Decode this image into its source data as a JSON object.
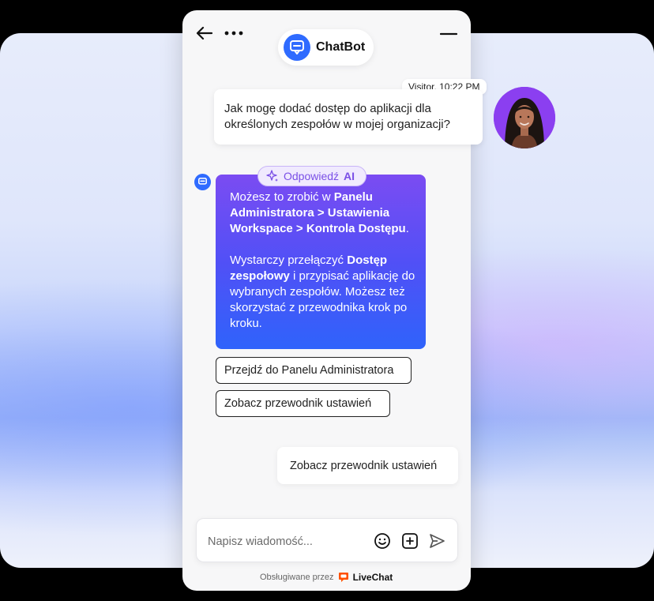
{
  "header": {
    "title": "ChatBot",
    "back_icon": "arrow-left-icon",
    "more_icon": "more-dots-icon",
    "minimize_icon": "minimize-icon"
  },
  "user_message": {
    "meta": "Visitor, 10:22 PM",
    "text_line1": "Jak mogę dodać dostęp do aplikacji dla",
    "text_line2": "określonych zespołów w mojej organizacji?"
  },
  "ai_message": {
    "badge_prefix": "Odpowiedź",
    "badge_ai": "AI",
    "p1_a": "Możesz to zrobić w ",
    "p1_b": "Panelu Administratora > Ustawienia Workspace > Kontrola Dostępu",
    "p1_c": ".",
    "p2_a": "Wystarczy przełączyć ",
    "p2_b": "Dostęp zespołowy",
    "p2_c": " i przypisać aplikację do wybranych zespołów. Możesz też skorzystać z przewodnika krok po kroku."
  },
  "actions": {
    "go_admin": "Przejdź do Panelu Administratora",
    "see_guide": "Zobacz przewodnik ustawień"
  },
  "sent_message": "Zobacz przewodnik ustawień",
  "composer": {
    "placeholder": "Napisz wiadomość...",
    "emoji_icon": "emoji-icon",
    "attach_icon": "add-attachment-icon",
    "send_icon": "send-icon"
  },
  "footer": {
    "powered_by": "Obsługiwane przez",
    "brand": "LiveChat"
  },
  "colors": {
    "accent": "#2f6bff",
    "ai_gradient_top": "#7b4cf2",
    "ai_gradient_bottom": "#2f63fb",
    "livechat_orange": "#ff5100"
  }
}
